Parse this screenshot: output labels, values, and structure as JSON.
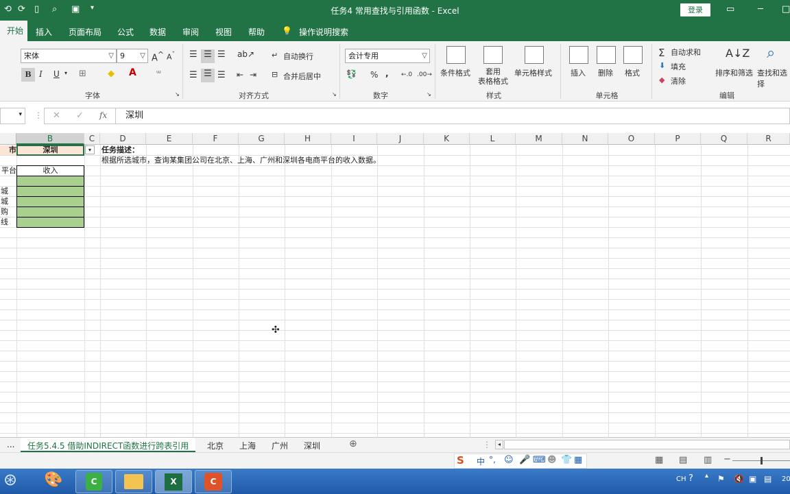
{
  "app": {
    "title": "任务4 常用查找与引用函数  -  Excel",
    "login": "登录"
  },
  "tabs": [
    "开始",
    "插入",
    "页面布局",
    "公式",
    "数据",
    "审阅",
    "视图",
    "帮助"
  ],
  "tell_me": "操作说明搜索",
  "ribbon": {
    "font_name": "宋体",
    "font_size": "9",
    "bold": "B",
    "italic": "I",
    "underline": "U",
    "wrap_text": "自动换行",
    "merge_center": "合并后居中",
    "number_format": "会计专用",
    "conditional_format": "条件格式",
    "table_format": "套用\n表格格式",
    "cell_styles": "单元格样式",
    "insert": "插入",
    "delete": "删除",
    "format": "格式",
    "autosum": "自动求和",
    "fill": "填充",
    "clear": "清除",
    "sort_filter": "排序和筛选",
    "find_select": "查找和选择",
    "groups": {
      "font": "字体",
      "align": "对齐方式",
      "number": "数字",
      "styles": "样式",
      "cells": "单元格",
      "editing": "编辑"
    }
  },
  "formula": {
    "fx": "fx",
    "value": "深圳"
  },
  "columns": [
    "B",
    "C",
    "D",
    "E",
    "F",
    "G",
    "H",
    "I",
    "J",
    "K",
    "L",
    "M",
    "N",
    "O",
    "P",
    "Q",
    "R"
  ],
  "cells": {
    "a1": "市",
    "b1": "深圳",
    "d1": "任务描述：",
    "d2": "根据所选城市，查询某集团公司在北京、上海、广州和深圳各电商平台的收入数据。",
    "a3": "平台",
    "b3": "收入",
    "a5": "城",
    "a6": "城",
    "a7": "购",
    "a8": "线"
  },
  "sheets": [
    "...",
    "任务5.4.5 借助INDIRECT函数进行跨表引用",
    "北京",
    "上海",
    "广州",
    "深圳"
  ],
  "colors": {
    "excel_green": "#217346",
    "cell_fill": "#a9d08e",
    "selected_fill": "#fce4d6"
  }
}
